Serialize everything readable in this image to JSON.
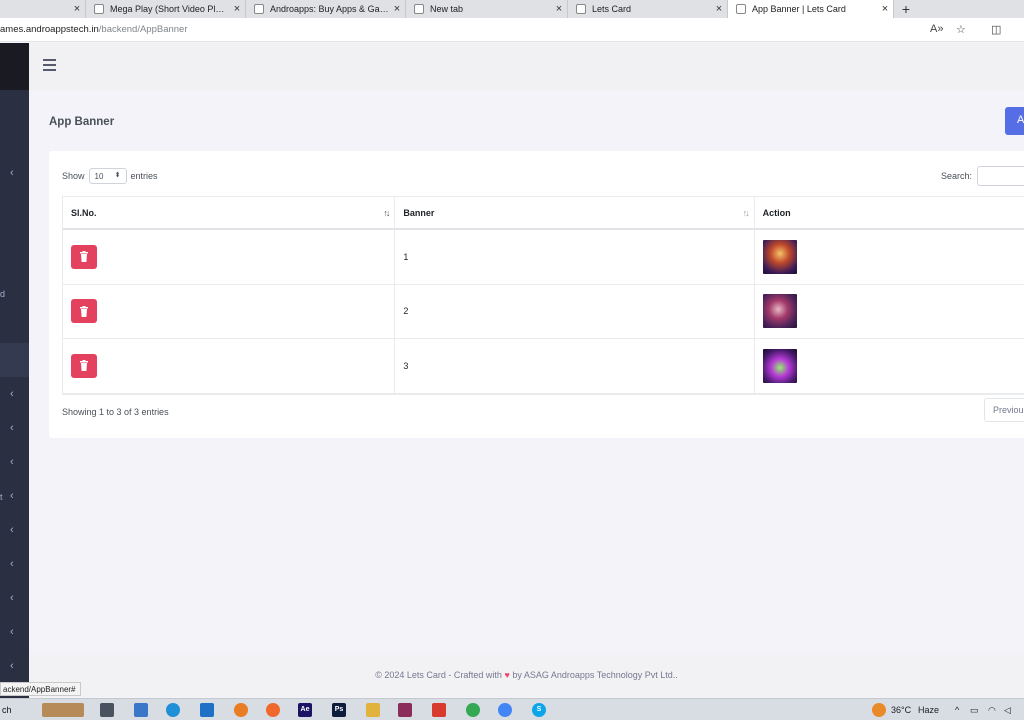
{
  "browser": {
    "tabs": [
      {
        "label": "",
        "active": false
      },
      {
        "label": "Mega Play (Short Video Platform",
        "active": false
      },
      {
        "label": "Androapps: Buy Apps & Games S",
        "active": false
      },
      {
        "label": "New tab",
        "active": false
      },
      {
        "label": "Lets Card",
        "active": false
      },
      {
        "label": "App Banner | Lets Card",
        "active": true
      }
    ],
    "close_glyph": "×",
    "new_tab_glyph": "+",
    "url_host": "ames.androappstech.in",
    "url_path": "/backend/AppBanner",
    "read_aloud_icon": "A»",
    "favorite_icon": "☆",
    "split_icon": "◫"
  },
  "sidebar": {
    "chevron": "‹",
    "fragments": [
      "d",
      "t"
    ]
  },
  "page": {
    "title": "App Banner",
    "add_button_label": "A"
  },
  "table": {
    "show_label": "Show",
    "entries_label": "entries",
    "page_length": "10",
    "search_label": "Search:",
    "columns": [
      "Sl.No.",
      "Banner",
      "Action"
    ],
    "rows": [
      {
        "banner": "1"
      },
      {
        "banner": "2"
      },
      {
        "banner": "3"
      }
    ],
    "info": "Showing 1 to 3 of 3 entries",
    "previous_label": "Previou"
  },
  "footer": {
    "prefix": "© 2024 Lets Card - Crafted with",
    "heart": "♥",
    "suffix": "by ASAG Androapps Technology Pvt Ltd.."
  },
  "status_bar_url": "ackend/AppBanner#",
  "taskbar": {
    "search_fragment": "ch",
    "weather_temp": "36°C",
    "weather_desc": "Haze",
    "ae_label": "Ae",
    "ps_label": "Ps",
    "skype_label": "S"
  },
  "colors": {
    "accent": "#556ee6",
    "delete": "#e3415d",
    "sidebar": "#2a3042"
  }
}
